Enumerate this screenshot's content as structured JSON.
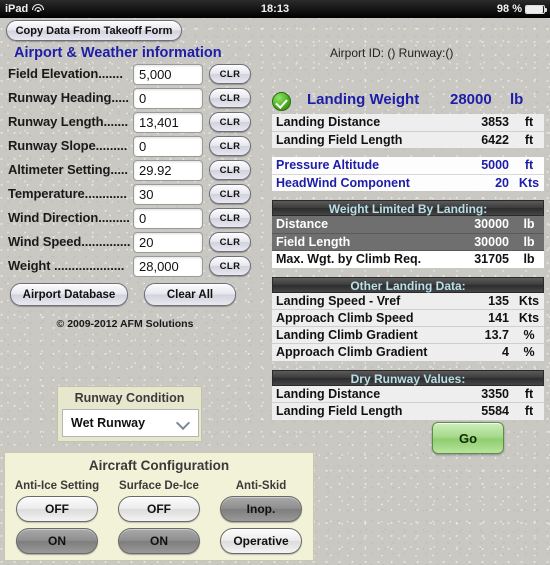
{
  "status_bar": {
    "device": "iPad",
    "wifi_icon": "wifi-icon",
    "time": "18:13",
    "battery_percent": "98 %",
    "battery_icon": "battery-icon"
  },
  "toolbar": {
    "copy_label": "Copy Data From Takeoff Form"
  },
  "headers": {
    "airport_weather": "Airport & Weather information",
    "airport_id": "Airport ID: () Runway:()"
  },
  "form": {
    "clear_label": "CLR",
    "fields": [
      {
        "label": "Field Elevation.......",
        "value": "5,000"
      },
      {
        "label": "Runway Heading.....",
        "value": "0"
      },
      {
        "label": "Runway Length.......",
        "value": "13,401"
      },
      {
        "label": "Runway Slope.........",
        "value": "0"
      },
      {
        "label": "Altimeter Setting.....",
        "value": "29.92"
      },
      {
        "label": "Temperature............",
        "value": "30"
      },
      {
        "label": "Wind Direction.........",
        "value": "0"
      },
      {
        "label": "Wind Speed..............",
        "value": "20"
      },
      {
        "label": "Weight ....................",
        "value": "28,000"
      }
    ],
    "airport_database_label": "Airport Database",
    "clear_all_label": "Clear All",
    "copyright": "© 2009-2012 AFM Solutions"
  },
  "runway_condition": {
    "title": "Runway Condition",
    "selected": "Wet Runway",
    "chevron_icon": "chevron-down-icon"
  },
  "aircraft_configuration": {
    "title": "Aircraft Configuration",
    "groups": [
      {
        "label": "Anti-Ice Setting",
        "options": [
          {
            "text": "OFF",
            "selected": false
          },
          {
            "text": "ON",
            "selected": true
          }
        ]
      },
      {
        "label": "Surface De-Ice",
        "options": [
          {
            "text": "OFF",
            "selected": false
          },
          {
            "text": "ON",
            "selected": true
          }
        ]
      },
      {
        "label": "Anti-Skid",
        "options": [
          {
            "text": "Inop.",
            "selected": true
          },
          {
            "text": "Operative",
            "selected": false
          }
        ]
      }
    ]
  },
  "results": {
    "status_icon": "check-circle-icon",
    "landing_weight_label": "Landing Weight",
    "landing_weight_value": "28000",
    "landing_weight_unit": "lb",
    "primary": [
      {
        "name": "Landing Distance",
        "value": "3853",
        "unit": "ft"
      },
      {
        "name": "Landing Field Length",
        "value": "6422",
        "unit": "ft"
      }
    ],
    "conditions": [
      {
        "name": "Pressure Altitude",
        "value": "5000",
        "unit": "ft"
      },
      {
        "name": "HeadWind Component",
        "value": "20",
        "unit": "Kts"
      }
    ],
    "weight_limited": {
      "title": "Weight Limited By Landing:",
      "rows": [
        {
          "name": "Distance",
          "value": "30000",
          "unit": "lb",
          "style": "dark"
        },
        {
          "name": "Field Length",
          "value": "30000",
          "unit": "lb",
          "style": "dark"
        }
      ],
      "max_row": {
        "name": "Max. Wgt. by Climb Req.",
        "value": "31705",
        "unit": "lb"
      }
    },
    "other_landing": {
      "title": "Other Landing Data:",
      "rows": [
        {
          "name": "Landing Speed - Vref",
          "value": "135",
          "unit": "Kts"
        },
        {
          "name": "Approach Climb Speed",
          "value": "141",
          "unit": "Kts"
        },
        {
          "name": "Landing Climb Gradient",
          "value": "13.7",
          "unit": "%"
        },
        {
          "name": "Approach Climb Gradient",
          "value": "4",
          "unit": "%"
        }
      ]
    },
    "dry_runway": {
      "title": "Dry Runway Values:",
      "rows": [
        {
          "name": "Landing Distance",
          "value": "3350",
          "unit": "ft"
        },
        {
          "name": "Landing Field Length",
          "value": "5584",
          "unit": "ft"
        }
      ]
    },
    "go_label": "Go"
  },
  "colors": {
    "accent_blue": "#1d1da8",
    "panel_cream": "#f2f2d8",
    "go_green": "#8fcd6f",
    "section_header_text": "#b9e0ea"
  }
}
